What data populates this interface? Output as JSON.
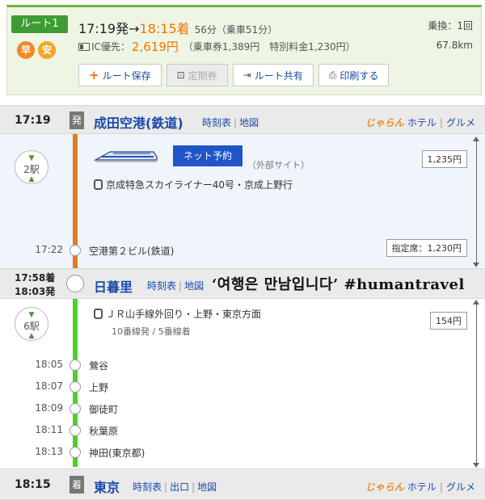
{
  "summary": {
    "route_label": "ルート1",
    "marks": [
      "早",
      "安"
    ],
    "depart": "17:19発",
    "arrow": "→",
    "arrive": "18:15着",
    "duration": "56分（乗車51分）",
    "ic_label": "IC優先：",
    "fare": "2,619円",
    "fare_detail": "（乗車券1,389円　特別料金1,230円）",
    "transfers": "乗換：1回",
    "distance": "67.8km",
    "buttons": {
      "save": "ルート保存",
      "pass": "定期券",
      "share": "ルート共有",
      "print": "印刷する"
    }
  },
  "stops": {
    "origin": {
      "time": "17:19",
      "tag": "発",
      "name": "成田空港(鉄道)",
      "links": [
        "時刻表",
        "地図"
      ],
      "hotel": "ホテル",
      "gourmet": "グルメ",
      "logo": "じゃらん"
    },
    "transfer": {
      "time_arr": "17:58着",
      "time_dep": "18:03発",
      "name": "日暮里",
      "links": [
        "時刻表",
        "地図"
      ]
    },
    "dest": {
      "time": "18:15",
      "tag": "着",
      "name": "東京",
      "links": [
        "時刻表",
        "出口",
        "地図"
      ],
      "hotel": "ホテル",
      "gourmet": "グルメ",
      "logo": "じゃらん"
    }
  },
  "leg1": {
    "count": "2駅",
    "reserve": "ネット予約",
    "external": "（外部サイト）",
    "train": "京成特急スカイライナー40号・京成上野行",
    "fare": "1,235円",
    "reserved_fare": "指定席：1,230円",
    "mid_stops": [
      {
        "time": "17:22",
        "name": "空港第２ビル(鉄道)"
      }
    ]
  },
  "leg2": {
    "count": "6駅",
    "train": "ＪＲ山手線外回り・上野・東京方面",
    "platform": "10番線発 / 5番線着",
    "fare": "154円",
    "mid_stops": [
      {
        "time": "18:05",
        "name": "鶯谷"
      },
      {
        "time": "18:07",
        "name": "上野"
      },
      {
        "time": "18:09",
        "name": "御徒町"
      },
      {
        "time": "18:11",
        "name": "秋葉原"
      },
      {
        "time": "18:13",
        "name": "神田(東京都)"
      }
    ]
  },
  "caption": "‘여행은 만남입니다’ #humantravel",
  "colors": {
    "accent_green": "#3f9c35",
    "orange_line": "#e07b28",
    "green_line": "#4dd02c",
    "link_blue": "#1a4aa8",
    "arrive_orange": "#ee7700"
  }
}
